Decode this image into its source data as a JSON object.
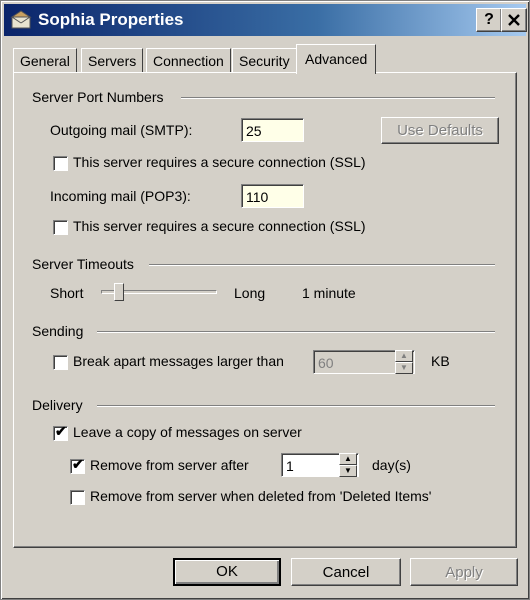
{
  "window": {
    "title": "Sophia Properties",
    "help_button": "?",
    "close_button": "X"
  },
  "tabs": [
    "General",
    "Servers",
    "Connection",
    "Security",
    "Advanced"
  ],
  "server_ports": {
    "group": "Server Port Numbers",
    "outgoing_label": "Outgoing mail (SMTP):",
    "outgoing_value": "25",
    "use_defaults": "Use Defaults",
    "ssl_outgoing": "This server requires a secure connection (SSL)",
    "incoming_label": "Incoming mail (POP3):",
    "incoming_value": "110",
    "ssl_incoming": "This server requires a secure connection (SSL)"
  },
  "timeouts": {
    "group": "Server Timeouts",
    "short": "Short",
    "long": "Long",
    "value": "1 minute"
  },
  "sending": {
    "group": "Sending",
    "break_apart": "Break apart messages larger than",
    "size_value": "60",
    "unit": "KB"
  },
  "delivery": {
    "group": "Delivery",
    "leave_copy": "Leave a copy of messages on server",
    "remove_after": "Remove from server after",
    "days_value": "1",
    "days_unit": "day(s)",
    "remove_deleted": "Remove from server when deleted from 'Deleted Items'"
  },
  "buttons": {
    "ok": "OK",
    "cancel": "Cancel",
    "apply": "Apply"
  }
}
